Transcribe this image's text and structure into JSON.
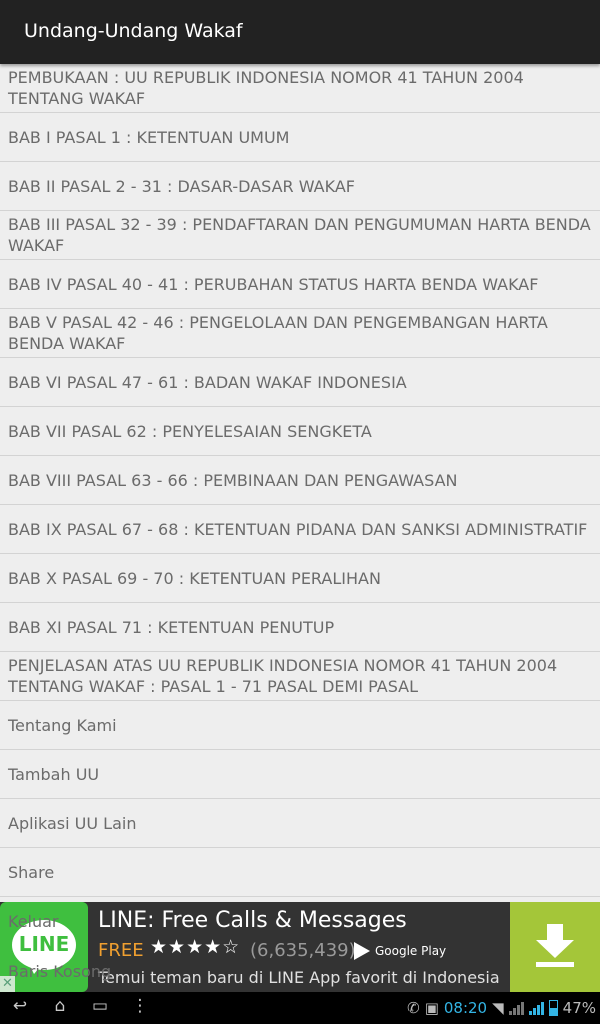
{
  "app": {
    "title": "Undang-Undang Wakaf"
  },
  "menu": {
    "items": [
      {
        "label": "PEMBUKAAN : UU REPUBLIK INDONESIA NOMOR 41 TAHUN 2004 TENTANG WAKAF"
      },
      {
        "label": "BAB I PASAL 1 : KETENTUAN UMUM"
      },
      {
        "label": "BAB II PASAL 2 - 31 : DASAR-DASAR WAKAF"
      },
      {
        "label": "BAB III PASAL 32 - 39 : PENDAFTARAN DAN PENGUMUMAN HARTA BENDA WAKAF"
      },
      {
        "label": "BAB IV PASAL 40 - 41 : PERUBAHAN STATUS HARTA BENDA WAKAF"
      },
      {
        "label": "BAB V PASAL 42 - 46 : PENGELOLAAN DAN PENGEMBANGAN HARTA BENDA WAKAF"
      },
      {
        "label": "BAB VI PASAL 47 - 61 : BADAN WAKAF INDONESIA"
      },
      {
        "label": "BAB VII PASAL 62 : PENYELESAIAN SENGKETA"
      },
      {
        "label": "BAB VIII PASAL 63 - 66 : PEMBINAAN DAN PENGAWASAN"
      },
      {
        "label": "BAB IX PASAL 67 - 68 : KETENTUAN PIDANA DAN SANKSI ADMINISTRATIF"
      },
      {
        "label": "BAB X PASAL 69 - 70 : KETENTUAN PERALIHAN"
      },
      {
        "label": "BAB XI PASAL 71 : KETENTUAN PENUTUP"
      },
      {
        "label": "PENJELASAN ATAS UU REPUBLIK INDONESIA NOMOR 41 TAHUN 2004 TENTANG WAKAF : PASAL 1 - 71 PASAL DEMI PASAL"
      },
      {
        "label": "Tentang Kami"
      },
      {
        "label": "Tambah UU"
      },
      {
        "label": "Aplikasi UU Lain"
      },
      {
        "label": "Share"
      },
      {
        "label": "Keluar"
      },
      {
        "label": "Baris Kosong"
      }
    ]
  },
  "ad": {
    "app_icon_text": "LINE",
    "title": "LINE: Free Calls & Messages",
    "price": "FREE",
    "stars": "★★★★☆",
    "rating": 4,
    "rating_count": "(6,635,439)",
    "store": "Google Play",
    "description": "Temui teman baru di LINE App favorit di Indonesia",
    "close_symbol": "✕",
    "colors": {
      "download": "#a4c639",
      "price": "#f0a030",
      "icon": "#3fbf3f"
    }
  },
  "navbar": {
    "back": "↩",
    "home": "⌂",
    "recents": "▭",
    "menu": "⋮"
  },
  "status": {
    "time": "08:20",
    "battery": "47%",
    "battery_level": 0.47,
    "accent": "#33b5e5"
  }
}
